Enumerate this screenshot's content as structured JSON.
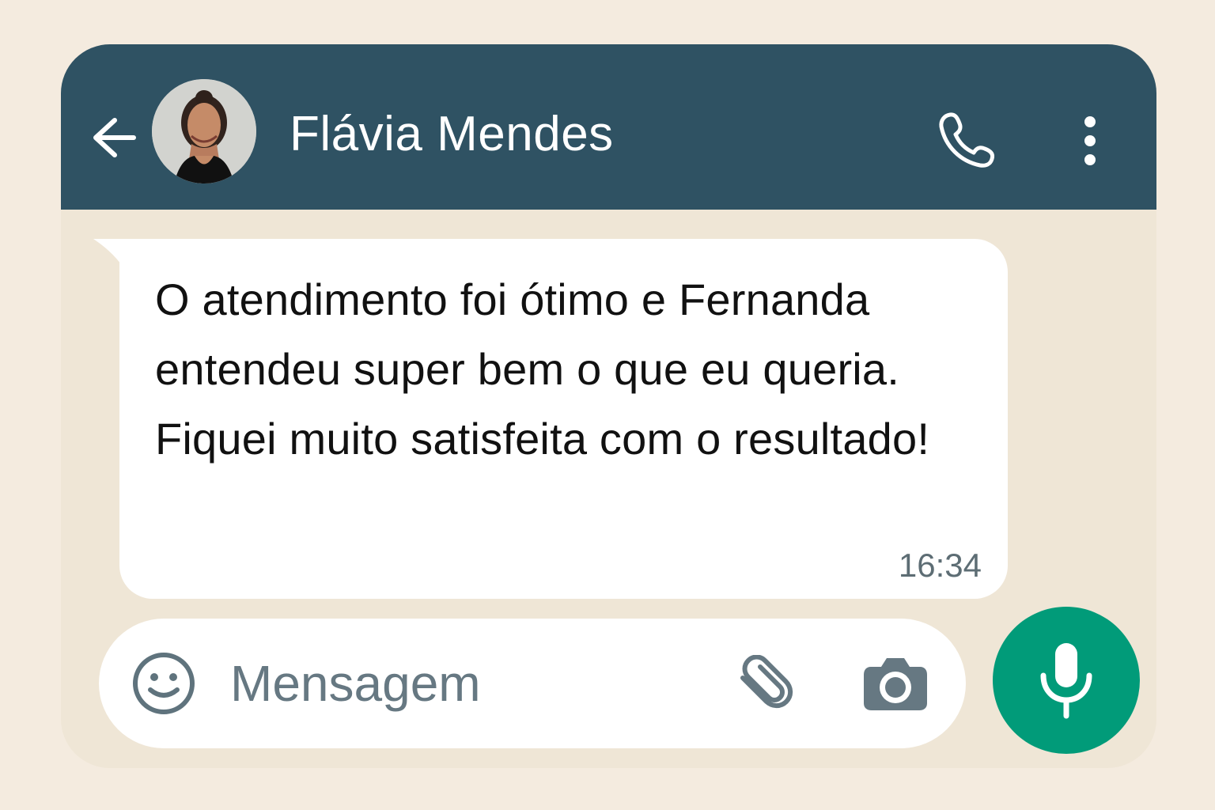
{
  "header": {
    "contact_name": "Flávia Mendes",
    "back_icon": "arrow-left-icon",
    "call_icon": "phone-icon",
    "menu_icon": "vertical-ellipsis-icon",
    "background_color": "#2f5263"
  },
  "conversation": {
    "message_text": "O atendimento foi ótimo e Fernanda entendeu super bem o que eu queria. Fiquei muito satisfeita com o resultado!",
    "message_time": "16:34",
    "bubble_color": "#ffffff",
    "chat_background": "#efe6d6"
  },
  "composer": {
    "placeholder": "Mensagem",
    "emoji_icon": "smile-icon",
    "attach_icon": "paperclip-icon",
    "camera_icon": "camera-icon",
    "mic_icon": "microphone-icon",
    "accent_color": "#019b79"
  }
}
